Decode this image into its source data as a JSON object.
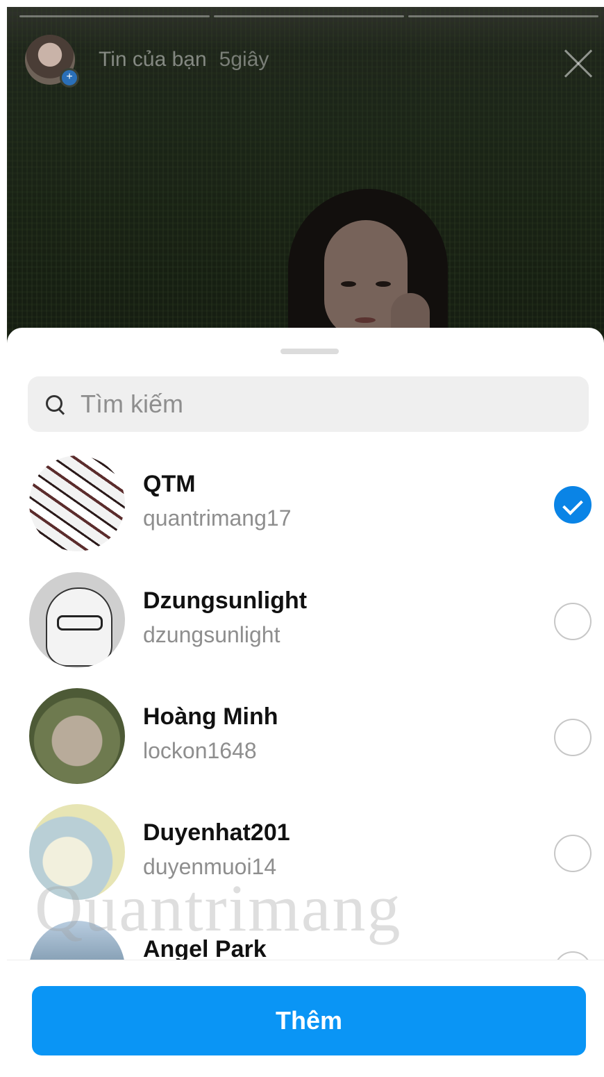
{
  "story": {
    "title": "Tin của bạn",
    "time": "5giây"
  },
  "search": {
    "placeholder": "Tìm kiếm"
  },
  "contacts": [
    {
      "name": "QTM",
      "username": "quantrimang17",
      "selected": true
    },
    {
      "name": "Dzungsunlight",
      "username": "dzungsunlight",
      "selected": false
    },
    {
      "name": "Hoàng Minh",
      "username": "lockon1648",
      "selected": false
    },
    {
      "name": "Duyenhat201",
      "username": "duyenmuoi14",
      "selected": false
    },
    {
      "name": "Angel Park",
      "username": "",
      "selected": false
    }
  ],
  "watermark": "Quantrimang",
  "footer": {
    "add_label": "Thêm"
  },
  "colors": {
    "accent": "#0a95f5",
    "checked": "#0a84e6"
  }
}
